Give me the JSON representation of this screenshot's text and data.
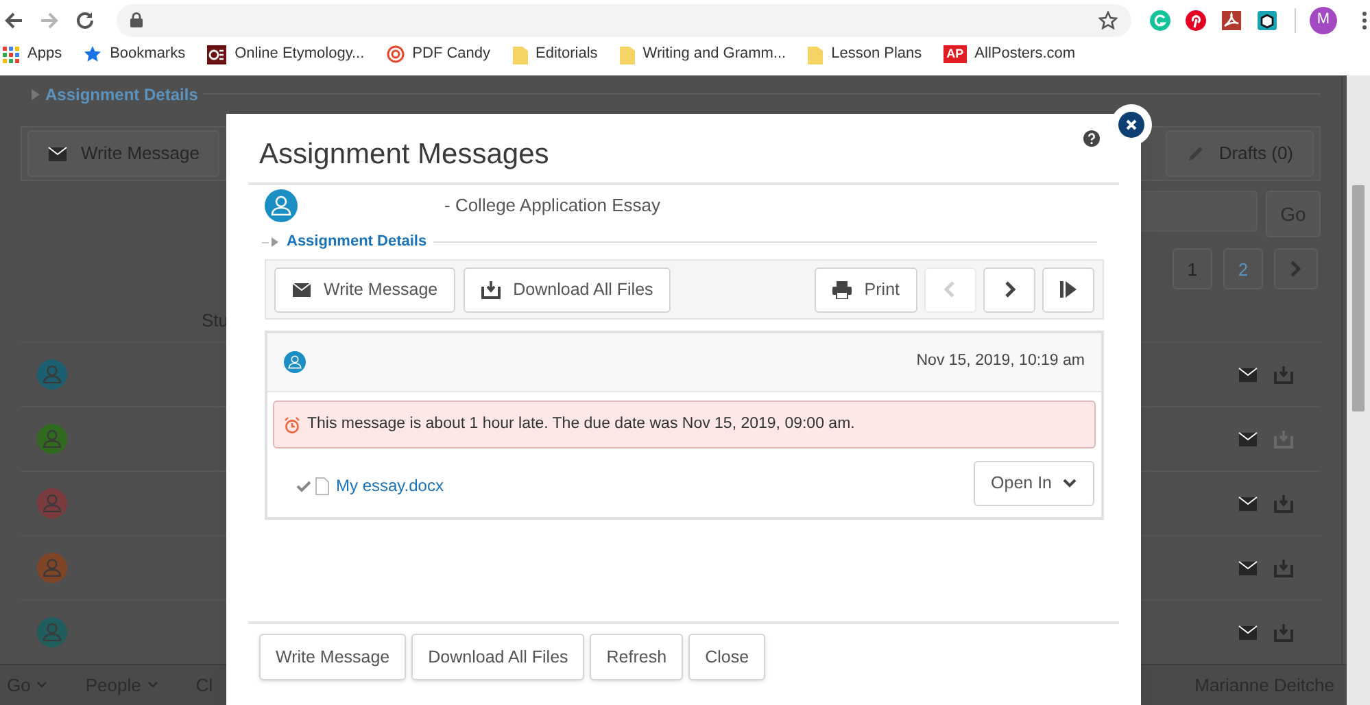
{
  "browser": {
    "nav_buttons": [
      {
        "kind": "back",
        "disabled": false
      },
      {
        "kind": "forward",
        "disabled": true
      },
      {
        "kind": "reload",
        "disabled": false
      }
    ],
    "extensions": [
      {
        "kind": "grammar",
        "color": "#15c39a"
      },
      {
        "kind": "pin",
        "color": "#e60023"
      },
      {
        "kind": "pdf",
        "color": "#b03a2e"
      },
      {
        "kind": "cube",
        "color": "#1aa3b5"
      }
    ],
    "profile_initial": "M",
    "bookmarks": [
      {
        "kind": "apps",
        "label": "Apps"
      },
      {
        "kind": "star",
        "label": "Bookmarks"
      },
      {
        "kind": "oe",
        "label": "Online Etymology..."
      },
      {
        "kind": "candy",
        "label": "PDF Candy"
      },
      {
        "kind": "folder",
        "label": "Editorials"
      },
      {
        "kind": "folder",
        "label": "Writing and Gramm..."
      },
      {
        "kind": "folder",
        "label": "Lesson Plans"
      },
      {
        "kind": "ap",
        "label": "AllPosters.com",
        "badge": "AP"
      }
    ]
  },
  "background_page": {
    "details_link": "Assignment Details",
    "toolbar": [
      {
        "kind": "mail",
        "label": "Write Message"
      },
      {
        "kind": "pencil",
        "label": "Drafts (0)"
      }
    ],
    "go_button": "Go",
    "pages": [
      {
        "label": "1",
        "selected": true
      },
      {
        "label": "2",
        "selected": false
      }
    ],
    "column_header": "Stu",
    "rows": [
      {
        "color": "#1c5f70",
        "download_disabled": false
      },
      {
        "color": "#2f6a1e",
        "download_disabled": true
      },
      {
        "color": "#7a3a3e",
        "download_disabled": false
      },
      {
        "color": "#7f4526",
        "download_disabled": false
      },
      {
        "color": "#1f5e5c",
        "download_disabled": false
      }
    ],
    "bottom_bar": {
      "menus": [
        "Go",
        "People"
      ],
      "partial_menu": "Cl",
      "user": "Marianne Deitche"
    }
  },
  "modal": {
    "title": "Assignment Messages",
    "subject": "- College Application Essay",
    "details_link": "Assignment Details",
    "toolbar_buttons": [
      {
        "kind": "mail",
        "label": "Write Message"
      },
      {
        "kind": "download",
        "label": "Download All Files"
      }
    ],
    "print_button": "Print",
    "nav_buttons": [
      {
        "kind": "prev",
        "disabled": true
      },
      {
        "kind": "next",
        "disabled": false
      },
      {
        "kind": "last",
        "disabled": false
      }
    ],
    "message": {
      "date": "Nov 15, 2019, 10:19 am",
      "alert": "This message is about 1 hour late. The due date was Nov 15, 2019, 09:00 am.",
      "file": {
        "name": "My essay.docx",
        "checked": true
      },
      "open_in": "Open In"
    },
    "footer_buttons": [
      "Write Message",
      "Download All Files",
      "Refresh",
      "Close"
    ]
  }
}
